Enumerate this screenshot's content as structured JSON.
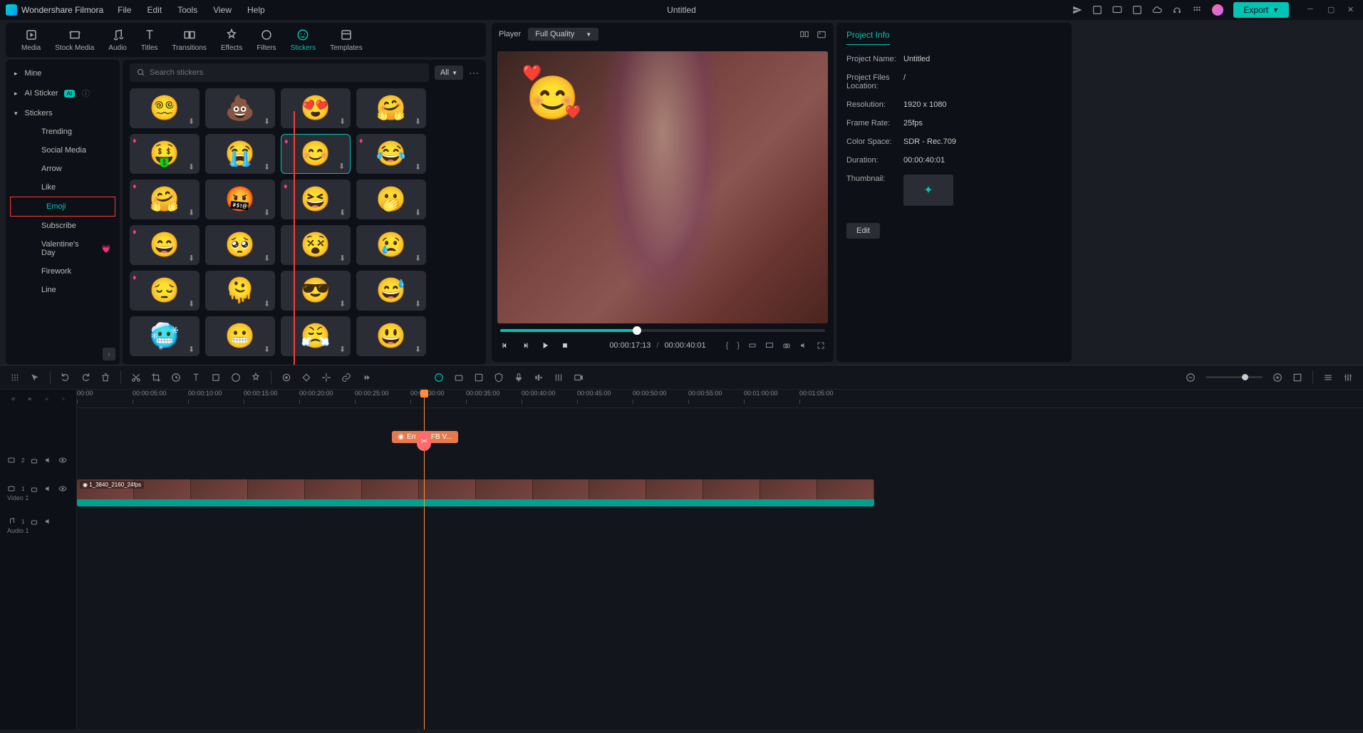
{
  "app": {
    "name": "Wondershare Filmora",
    "document": "Untitled"
  },
  "menubar": [
    "File",
    "Edit",
    "Tools",
    "View",
    "Help"
  ],
  "export_label": "Export",
  "top_tabs": [
    {
      "label": "Media"
    },
    {
      "label": "Stock Media"
    },
    {
      "label": "Audio"
    },
    {
      "label": "Titles"
    },
    {
      "label": "Transitions"
    },
    {
      "label": "Effects"
    },
    {
      "label": "Filters"
    },
    {
      "label": "Stickers",
      "active": true
    },
    {
      "label": "Templates"
    }
  ],
  "sidebar": {
    "mine": "Mine",
    "ai_sticker": "AI Sticker",
    "stickers": "Stickers",
    "items": [
      "Trending",
      "Social Media",
      "Arrow",
      "Like",
      "Emoji",
      "Subscribe",
      "Valentine's Day",
      "Firework",
      "Line"
    ]
  },
  "search": {
    "placeholder": "Search stickers",
    "filter": "All"
  },
  "stickers": {
    "grid": [
      [
        "😵‍💫",
        "💩",
        "😍",
        "🤗"
      ],
      [
        "🤑",
        "😭",
        "😊",
        "😂"
      ],
      [
        "🤗",
        "🤬",
        "😆",
        "🫢"
      ],
      [
        "😄",
        "🥺",
        "😵",
        "😢"
      ],
      [
        "😔",
        "🫠",
        "😎",
        "😅"
      ],
      [
        "🥶",
        "😬",
        "😤",
        "😃"
      ]
    ],
    "selected_row": 1,
    "selected_col": 2,
    "premium_cells": [
      [
        1,
        0
      ],
      [
        1,
        2
      ],
      [
        1,
        3
      ],
      [
        2,
        0
      ],
      [
        2,
        2
      ],
      [
        3,
        0
      ],
      [
        4,
        0
      ]
    ]
  },
  "player": {
    "label": "Player",
    "quality": "Full Quality",
    "current_time": "00:00:17:13",
    "total_time": "00:00:40:01"
  },
  "project_info": {
    "title": "Project Info",
    "name_key": "Project Name:",
    "name_val": "Untitled",
    "loc_key": "Project Files Location:",
    "loc_val": "/",
    "res_key": "Resolution:",
    "res_val": "1920 x 1080",
    "fr_key": "Frame Rate:",
    "fr_val": "25fps",
    "cs_key": "Color Space:",
    "cs_val": "SDR - Rec.709",
    "dur_key": "Duration:",
    "dur_val": "00:00:40:01",
    "thumb_key": "Thumbnail:",
    "edit": "Edit"
  },
  "timeline": {
    "ruler": [
      "00:00",
      "00:00:05:00",
      "00:00:10:00",
      "00:00:15:00",
      "00:00:20:00",
      "00:00:25:00",
      "00:00:30:00",
      "00:00:35:00",
      "00:00:40:00",
      "00:00:45:00",
      "00:00:50:00",
      "00:00:55:00",
      "00:01:00:00",
      "00:01:05:00"
    ],
    "playhead_pct": 27,
    "sticker_clip_label": "Err ojis FB V...",
    "video_clip_label": "1_3840_2160_24fps",
    "tracks": [
      {
        "icon": "video",
        "num": "2",
        "label": ""
      },
      {
        "icon": "video",
        "num": "1",
        "label": "Video 1"
      },
      {
        "icon": "audio",
        "num": "1",
        "label": "Audio 1"
      }
    ]
  }
}
